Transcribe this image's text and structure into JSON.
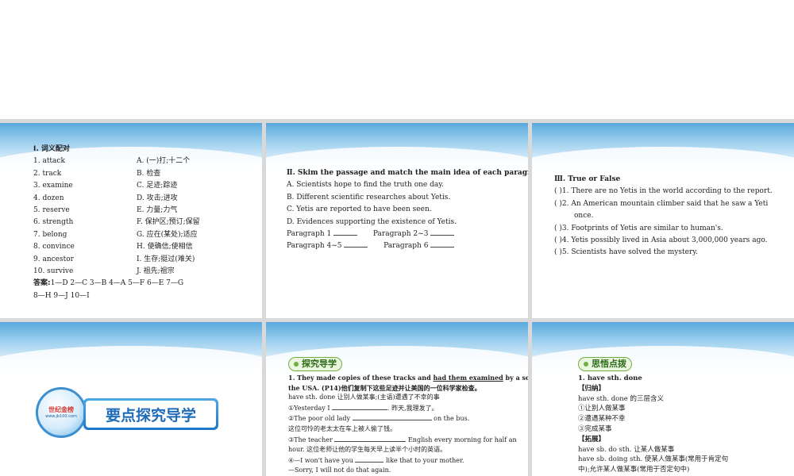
{
  "slide1": {
    "heading": "Ⅰ. 词义配对",
    "words": [
      "1. attack",
      "2. track",
      "3. examine",
      "4. dozen",
      "5. reserve",
      "6. strength",
      "7. belong",
      "8. convince",
      "9. ancestor",
      "10. survive"
    ],
    "meanings": [
      "A. (一)打;十二个",
      "B. 检查",
      "C. 足迹;踪迹",
      "D. 攻击;进攻",
      "E. 力量;力气",
      "F. 保护区;预订;保留",
      "G. 应在(某处);适应",
      "H. 使确信;使相信",
      "I. 生存;挺过(难关)",
      "J. 祖先;祖宗"
    ],
    "answer_label": "答案:",
    "answer_line1": "1—D  2—C  3—B  4—A  5—F  6—E  7—G",
    "answer_line2": "8—H  9—J  10—I"
  },
  "slide2": {
    "heading": "Ⅱ. Skim the passage and match the main idea of each paragraph.",
    "options": [
      "A. Scientists hope to find the truth one day.",
      "B. Different scientific researches about Yetis.",
      "C. Yetis are reported to have been seen.",
      "D. Evidences supporting the existence of Yetis."
    ],
    "p1": "Paragraph 1",
    "p23": "Paragraph 2~3",
    "p45": "Paragraph 4~5",
    "p6": "Paragraph 6"
  },
  "slide3": {
    "heading": "Ⅲ. True or False",
    "items": [
      "(  )1. There are no Yetis in the world according to the report.",
      "(  )2. An American mountain climber said that he saw a Yeti",
      "once.",
      "(  )3. Footprints of Yetis are similar to human's.",
      "(  )4. Yetis possibly lived in Asia about 3,000,000 years ago.",
      "(  )5. Scientists have solved the mystery."
    ]
  },
  "slide4": {
    "logo_text": "世纪金榜",
    "logo_url": "www.jb100.com",
    "banner": "要点探究导学"
  },
  "slide5": {
    "tag": "探究导学",
    "q_pre": "1. They made copies of these tracks and ",
    "q_u": "had them examined",
    "q_post": " by a scientist in",
    "q_line2": "the USA. (P14)他们复制下这些足迹并让美国的一位科学家检查。",
    "rule": "have sth. done 让别人做某事;(主语)遭遇了不幸的事",
    "e1a": "①Yesterday I",
    "e1b": ". 昨天,我理发了。",
    "e2a": "②The poor old lady",
    "e2b": "on the bus.",
    "e2c": "这位可怜的老太太在车上被人偷了钱。",
    "e3a": "③The teacher",
    "e3b": "English every morning for half an",
    "e3c": "hour. 这位老师让他的学生每天早上读半个小时的英语。",
    "e4a": "④—I won't have you",
    "e4b": "like that to your mother.",
    "e4c": "—Sorry, I will not do that again."
  },
  "slide6": {
    "tag": "思悟点拨",
    "title": "1. have sth.  done",
    "sum_label": "【归纳】",
    "sum": "have sth. done 的三层含义",
    "m1": "①让别人做某事",
    "m2": "②遭遇某种不幸",
    "m3": "③完成某事",
    "ext_label": "【拓展】",
    "x1": "have sb. do sth. 让某人做某事",
    "x2": "have sb. doing sth. 使某人做某事(常用于肯定句",
    "x3": "中);允许某人做某事(常用于否定句中)"
  }
}
